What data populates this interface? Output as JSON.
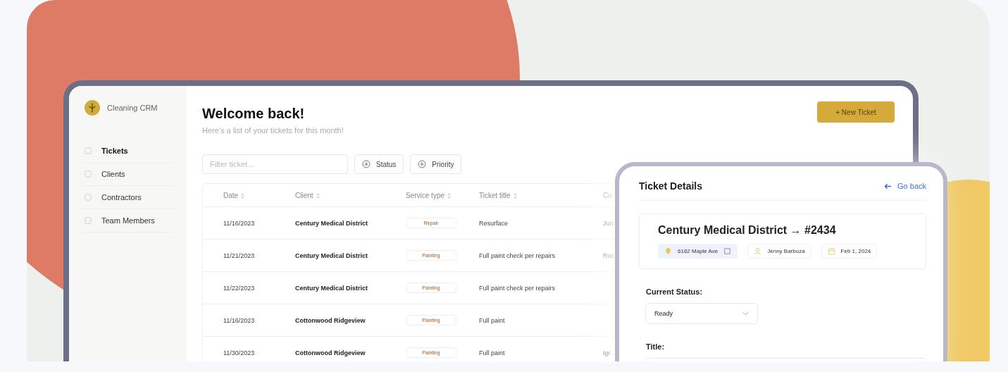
{
  "app": {
    "name": "Cleaning CRM"
  },
  "sidebar": {
    "items": [
      {
        "label": "Tickets",
        "selected": true
      },
      {
        "label": "Clients",
        "selected": false
      },
      {
        "label": "Contractors",
        "selected": false
      },
      {
        "label": "Team Members",
        "selected": false
      }
    ]
  },
  "header": {
    "title": "Welcome back!",
    "subtitle": "Here's a list of your tickets for this month!",
    "new_button": "+ New Ticket"
  },
  "filters": {
    "placeholder": "Filter ticket...",
    "buttons": [
      "Status",
      "Priority"
    ]
  },
  "table": {
    "columns": [
      "Date",
      "Client",
      "Service type",
      "Ticket title",
      "Co"
    ],
    "rows": [
      {
        "date": "11/16/2023",
        "client": "Century Medical District",
        "service": "Repair",
        "title": "Resurface",
        "column_5": "Jun"
      },
      {
        "date": "11/21/2023",
        "client": "Century Medical District",
        "service": "Painting",
        "title": "Full paint check per repairs",
        "column_5": "Roc"
      },
      {
        "date": "11/22/2023",
        "client": "Century Medical District",
        "service": "Painting",
        "title": "Full paint check per repairs",
        "column_5": ""
      },
      {
        "date": "11/16/2023",
        "client": "Cottonwood Ridgeview",
        "service": "Painting",
        "title": "Full paint",
        "column_5": ""
      },
      {
        "date": "11/30/2023",
        "client": "Cottonwood Ridgeview",
        "service": "Painting",
        "title": "Full paint",
        "column_5": "Igr"
      }
    ]
  },
  "details": {
    "title": "Ticket Details",
    "back_link": "Go back",
    "ticket": "Century Medical District → #2434",
    "chips": [
      {
        "kind": "address",
        "text": "6162 Maple Ave"
      },
      {
        "kind": "person",
        "text": "Jenny Barboza"
      },
      {
        "kind": "date",
        "text": "Feb 1, 2024"
      }
    ],
    "status_label": "Current Status:",
    "status_value": "Ready",
    "title_label": "Title:"
  }
}
